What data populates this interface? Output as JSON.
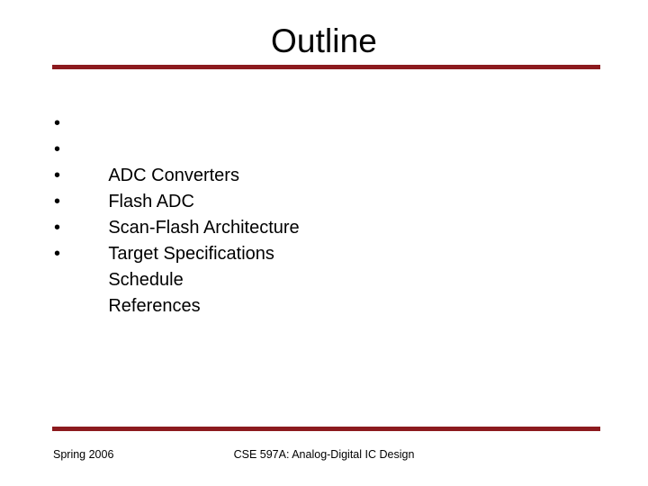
{
  "slide": {
    "title": "Outline",
    "accent_color": "#8C1A1E",
    "background_color": "#FFFFFF",
    "text_color": "#000000",
    "bullet_glyph": "•",
    "bullets": [
      {
        "text": "ADC Converters"
      },
      {
        "text": "Flash ADC"
      },
      {
        "text": "Scan-Flash Architecture"
      },
      {
        "text": "Target Specifications"
      },
      {
        "text": "Schedule"
      },
      {
        "text": "References"
      }
    ],
    "footer": {
      "left": "Spring 2006",
      "center": "CSE 597A: Analog-Digital IC Design"
    }
  }
}
